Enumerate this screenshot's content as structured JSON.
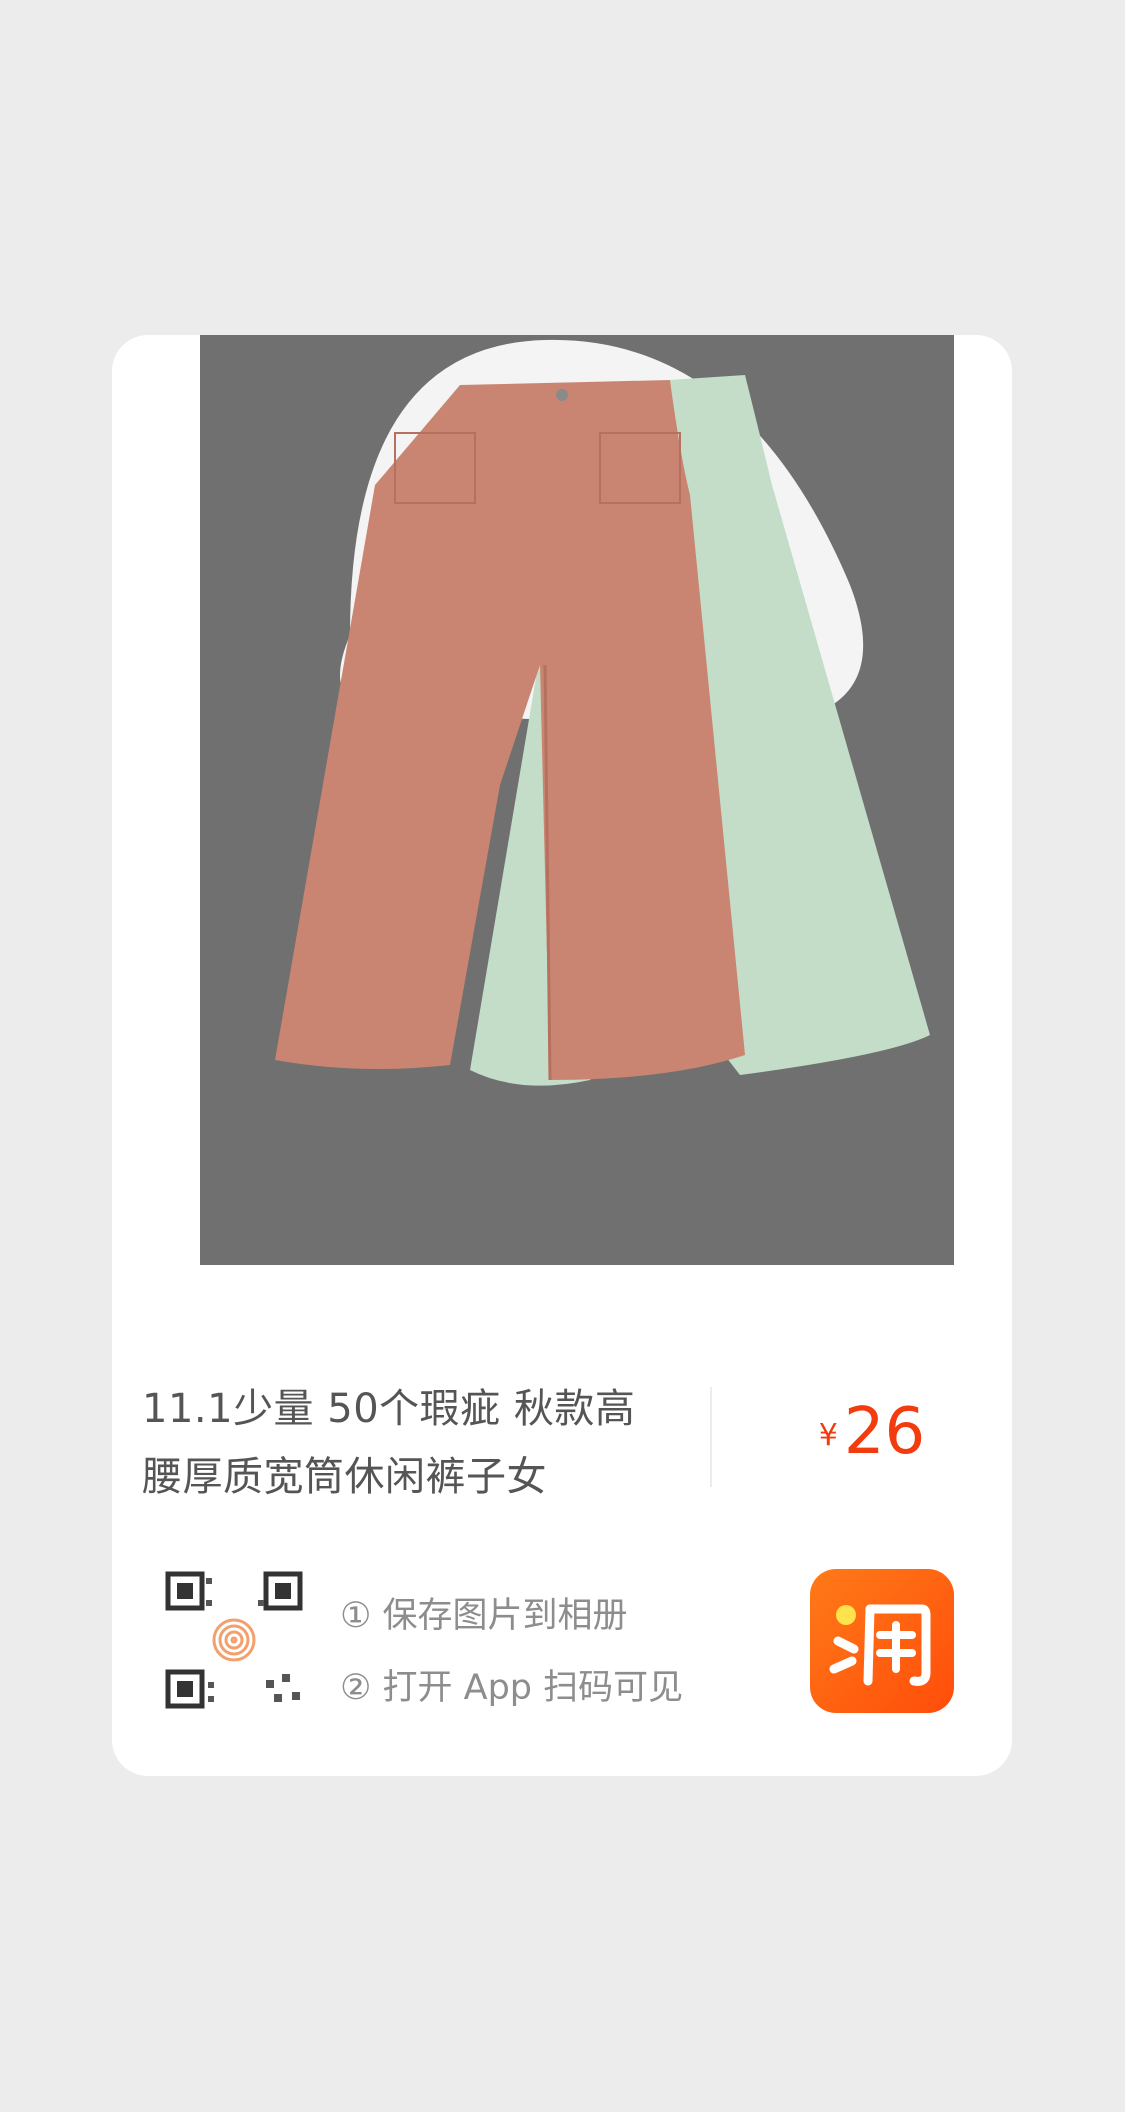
{
  "product": {
    "title_line1": "11.1少量 50个瑕疵 秋款高",
    "title_line2": "腰厚质宽筒休闲裤子女",
    "price_currency": "¥",
    "price_value": "26"
  },
  "instructions": {
    "step1": "① 保存图片到相册",
    "step2": "② 打开 App 扫码可见"
  },
  "icons": {
    "qr": "qr-code-icon",
    "fingerprint": "fingerprint-icon",
    "app": "taobao-app-icon"
  },
  "colors": {
    "background": "#ececec",
    "card": "#ffffff",
    "price": "#f23c0f",
    "title": "#555555",
    "instruction": "#8d8d8d",
    "accent": "#ff5a0a",
    "pants_pink": "#c98572",
    "pants_green": "#c3ddc9"
  }
}
